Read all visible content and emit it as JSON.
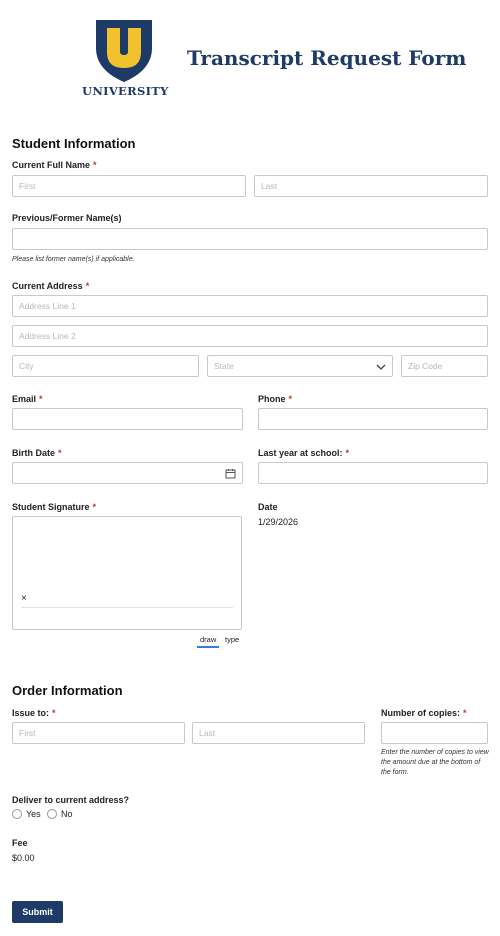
{
  "header": {
    "logo_text": "UNIVERSITY",
    "title": "Transcript Request Form",
    "brand_color": "#1e3a66",
    "accent_color": "#f2c12e"
  },
  "student": {
    "section_title": "Student Information",
    "full_name": {
      "label": "Current Full Name",
      "required": "*",
      "first_placeholder": "First",
      "last_placeholder": "Last"
    },
    "former_names": {
      "label": "Previous/Former Name(s)",
      "hint": "Please list former name(s) if applicable."
    },
    "address": {
      "label": "Current Address",
      "required": "*",
      "line1_placeholder": "Address Line 1",
      "line2_placeholder": "Address Line 2",
      "city_placeholder": "City",
      "state_placeholder": "State",
      "zip_placeholder": "Zip Code"
    },
    "email": {
      "label": "Email",
      "required": "*"
    },
    "phone": {
      "label": "Phone",
      "required": "*"
    },
    "birth_date": {
      "label": "Birth Date",
      "required": "*",
      "icon": "calendar-icon"
    },
    "last_year": {
      "label": "Last year at school:",
      "required": "*"
    },
    "signature": {
      "label": "Student Signature",
      "required": "*",
      "clear": "×",
      "tab_draw": "draw",
      "tab_type": "type"
    },
    "date": {
      "label": "Date",
      "value": "1/29/2026"
    }
  },
  "order": {
    "section_title": "Order Information",
    "issue_to": {
      "label": "Issue to:",
      "required": "*",
      "first_placeholder": "First",
      "last_placeholder": "Last"
    },
    "copies": {
      "label": "Number of copies:",
      "required": "*",
      "hint": "Enter the number of copies to view the amount due at the bottom of the form."
    },
    "deliver": {
      "label": "Deliver to current address?",
      "yes": "Yes",
      "no": "No"
    },
    "fee": {
      "label": "Fee",
      "value": "$0.00"
    }
  },
  "submit_label": "Submit"
}
